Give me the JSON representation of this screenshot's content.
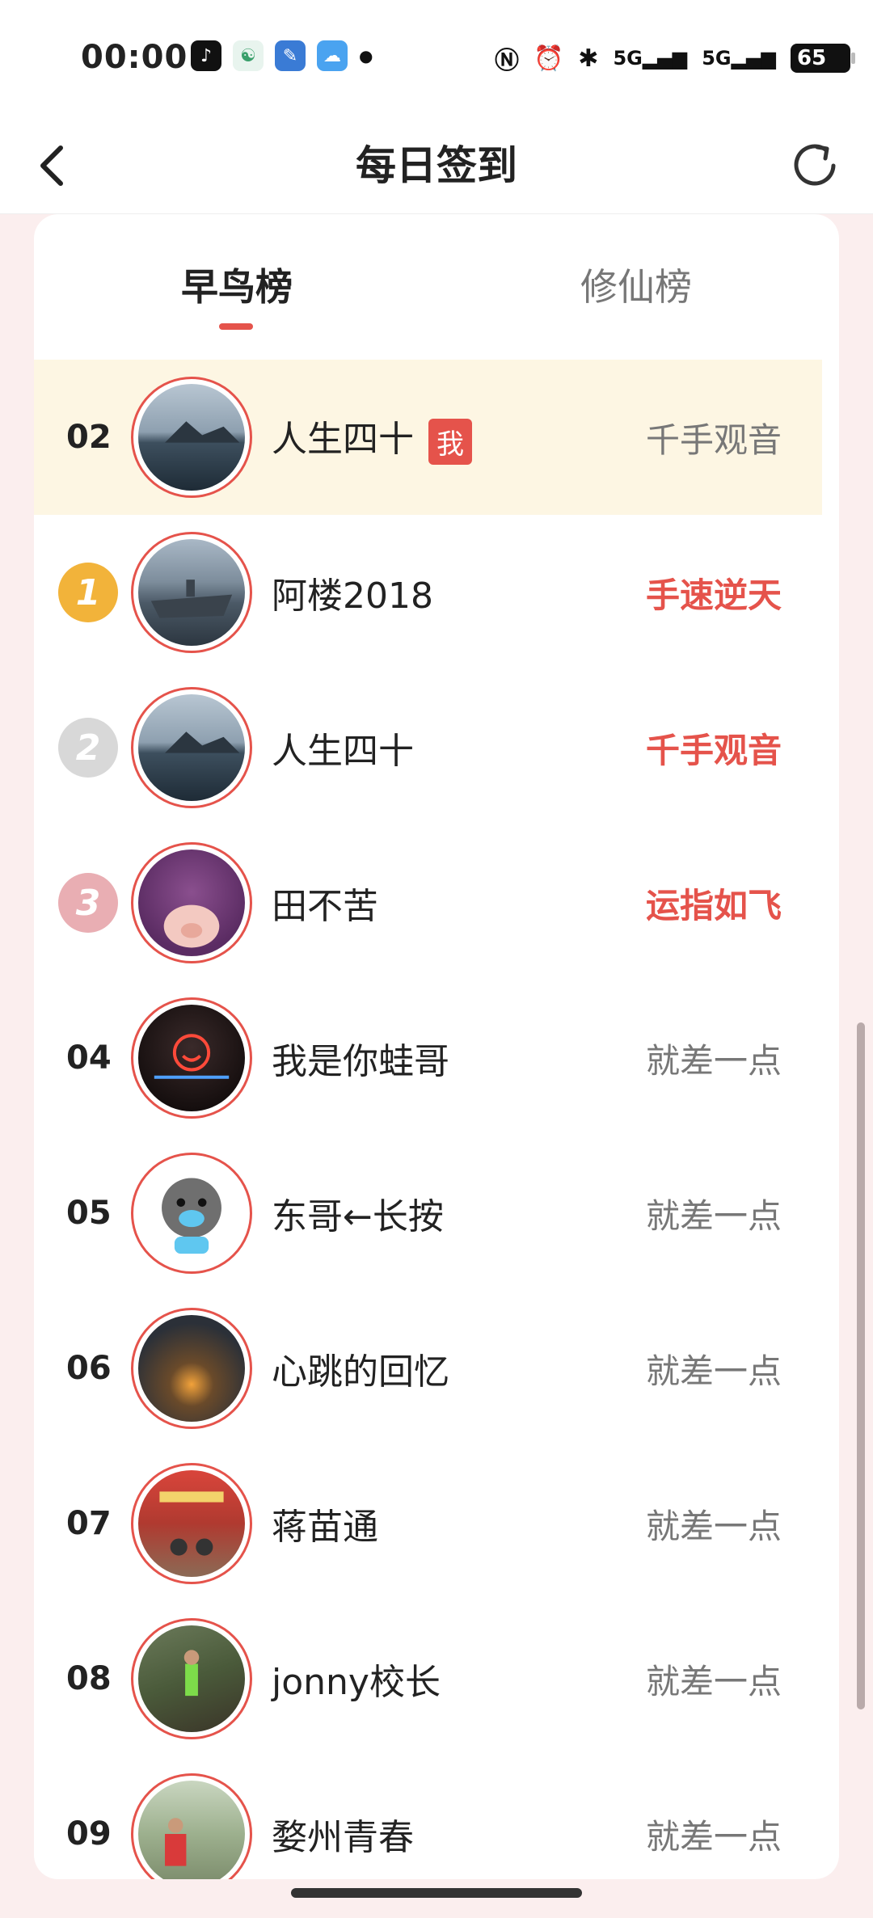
{
  "status": {
    "time": "00:00",
    "battery": "65",
    "signal_1": "5G",
    "signal_2": "5G"
  },
  "header": {
    "title": "每日签到"
  },
  "tabs": [
    {
      "label": "早鸟榜",
      "active": true
    },
    {
      "label": "修仙榜",
      "active": false
    }
  ],
  "rows": [
    {
      "rank": "02",
      "name": "人生四十",
      "me_badge": "我",
      "title": "千手观音",
      "highlight": true
    },
    {
      "rank": "1",
      "name": "阿楼2018",
      "title": "手速逆天"
    },
    {
      "rank": "2",
      "name": "人生四十",
      "title": "千手观音"
    },
    {
      "rank": "3",
      "name": "田不苦",
      "title": "运指如飞"
    },
    {
      "rank": "04",
      "name": "我是你蛙哥",
      "title": "就差一点"
    },
    {
      "rank": "05",
      "name": "东哥←长按",
      "title": "就差一点"
    },
    {
      "rank": "06",
      "name": "心跳的回忆",
      "title": "就差一点"
    },
    {
      "rank": "07",
      "name": "蒋苗通",
      "title": "就差一点"
    },
    {
      "rank": "08",
      "name": "jonny校长",
      "title": "就差一点"
    },
    {
      "rank": "09",
      "name": "婺州青春",
      "title": "就差一点"
    }
  ],
  "colors": {
    "accent": "#e5534b",
    "gold": "#f2b33a",
    "silver": "#d8d8d8",
    "bronze": "#e9aeb3"
  }
}
